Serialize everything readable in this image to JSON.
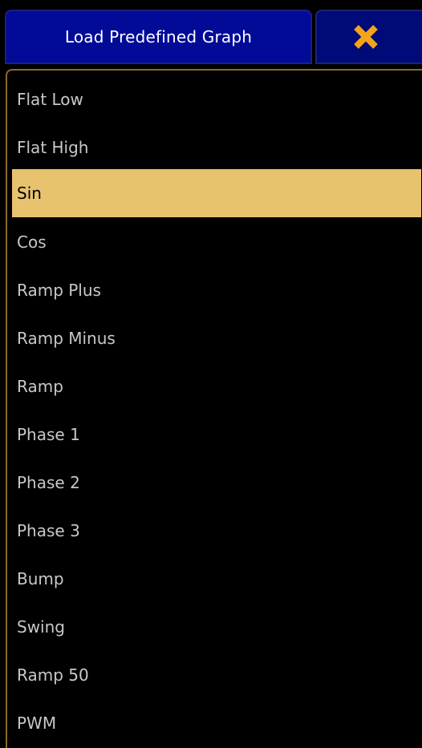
{
  "dialog": {
    "title": "Load Predefined Graph",
    "close_icon": "close-icon",
    "accent_color": "#f2a51a",
    "title_bg": "#020a98",
    "selected_bg": "#e8c36e"
  },
  "list": {
    "selected": "Sin",
    "items": [
      {
        "label": "Flat Low"
      },
      {
        "label": "Flat High"
      },
      {
        "label": "Sin"
      },
      {
        "label": "Cos"
      },
      {
        "label": "Ramp Plus"
      },
      {
        "label": "Ramp Minus"
      },
      {
        "label": "Ramp"
      },
      {
        "label": "Phase 1"
      },
      {
        "label": "Phase 2"
      },
      {
        "label": "Phase 3"
      },
      {
        "label": "Bump"
      },
      {
        "label": "Swing"
      },
      {
        "label": "Ramp 50"
      },
      {
        "label": "PWM"
      }
    ]
  }
}
